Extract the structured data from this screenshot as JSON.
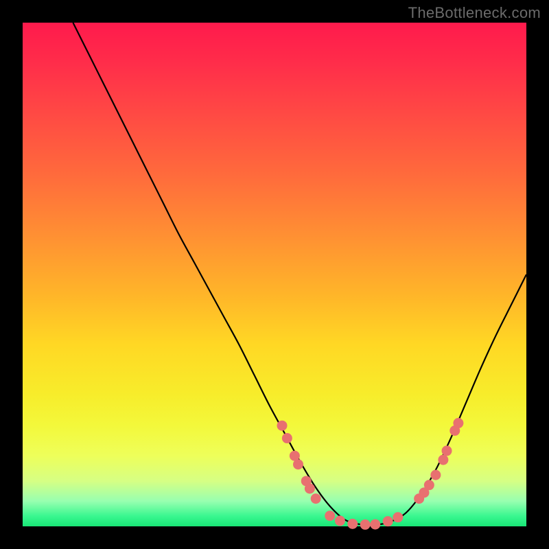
{
  "watermark": "TheBottleneck.com",
  "colors": {
    "background": "#000000",
    "curve": "#000000",
    "dot_fill": "#e87070",
    "dot_stroke": "#b54a4a"
  },
  "chart_data": {
    "type": "line",
    "title": "",
    "xlabel": "",
    "ylabel": "",
    "xlim": [
      0,
      100
    ],
    "ylim": [
      0,
      100
    ],
    "grid": false,
    "series": [
      {
        "name": "bottleneck-curve",
        "x": [
          10,
          13,
          16,
          19,
          22,
          25,
          28,
          31,
          34,
          37,
          40,
          43,
          46,
          49,
          52,
          55,
          58,
          61,
          64,
          67,
          70,
          73,
          76,
          79,
          82,
          85,
          88,
          91,
          94,
          97,
          100
        ],
        "y": [
          100,
          94,
          88,
          82,
          76,
          70,
          64,
          58,
          52.5,
          47,
          41.5,
          36,
          30,
          24,
          18.5,
          13,
          8,
          4,
          1.3,
          0.4,
          0.3,
          0.9,
          2.6,
          6.2,
          11.2,
          17.5,
          24.5,
          31.5,
          38,
          44,
          50
        ]
      }
    ],
    "markers": [
      {
        "x": 51.5,
        "y": 20
      },
      {
        "x": 52.5,
        "y": 17.5
      },
      {
        "x": 54,
        "y": 14
      },
      {
        "x": 54.7,
        "y": 12.3
      },
      {
        "x": 56.3,
        "y": 9
      },
      {
        "x": 57,
        "y": 7.5
      },
      {
        "x": 58.2,
        "y": 5.5
      },
      {
        "x": 61,
        "y": 2.1
      },
      {
        "x": 63,
        "y": 1.1
      },
      {
        "x": 65.5,
        "y": 0.5
      },
      {
        "x": 68,
        "y": 0.35
      },
      {
        "x": 70,
        "y": 0.4
      },
      {
        "x": 72.5,
        "y": 1.0
      },
      {
        "x": 74.5,
        "y": 1.8
      },
      {
        "x": 78.7,
        "y": 5.5
      },
      {
        "x": 79.7,
        "y": 6.7
      },
      {
        "x": 80.7,
        "y": 8.2
      },
      {
        "x": 82,
        "y": 10.2
      },
      {
        "x": 83.5,
        "y": 13.2
      },
      {
        "x": 84.2,
        "y": 15
      },
      {
        "x": 85.8,
        "y": 19
      },
      {
        "x": 86.5,
        "y": 20.5
      }
    ]
  }
}
